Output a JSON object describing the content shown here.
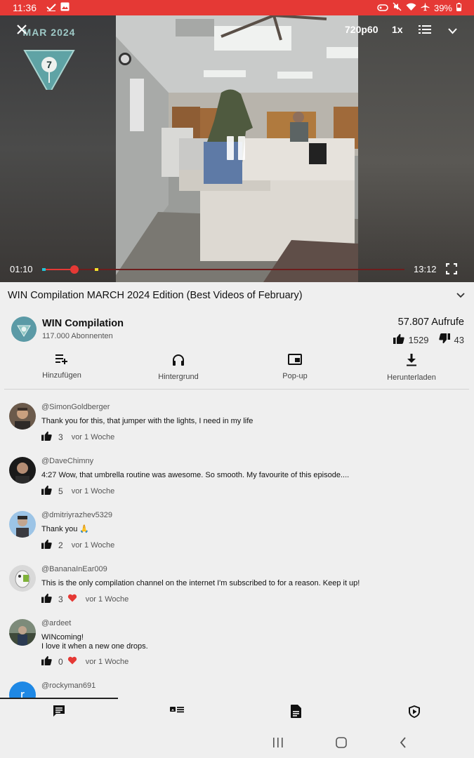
{
  "status_bar": {
    "time": "11:36",
    "battery": "39%"
  },
  "player": {
    "brand_text": "MAR 2024",
    "brand_number": "7",
    "quality": "720p60",
    "speed": "1x",
    "current_time": "01:10",
    "total_time": "13:12",
    "progress": 0.089
  },
  "video": {
    "title": "WIN Compilation MARCH 2024 Edition (Best Videos of February)",
    "channel_name": "WIN Compilation",
    "subscribers": "117.000 Abonnenten",
    "views": "57.807 Aufrufe",
    "likes": "1529",
    "dislikes": "43"
  },
  "actions": [
    {
      "label": "Hinzufügen",
      "icon": "playlist-add-icon"
    },
    {
      "label": "Hintergrund",
      "icon": "headphones-icon"
    },
    {
      "label": "Pop-up",
      "icon": "popup-icon"
    },
    {
      "label": "Herunterladen",
      "icon": "download-icon"
    }
  ],
  "comments": [
    {
      "user": "@SimonGoldberger",
      "text": "Thank you for this, that jumper with the lights, I need in my life",
      "likes": "3",
      "hearted": false,
      "ago": "vor 1 Woche"
    },
    {
      "user": "@DaveChimny",
      "text": "4:27 Wow, that umbrella routine was awesome. So smooth. My favourite of this episode....",
      "likes": "5",
      "hearted": false,
      "ago": "vor 1 Woche"
    },
    {
      "user": "@dmitriyrazhev5329",
      "text": "Thank you 🙏",
      "likes": "2",
      "hearted": false,
      "ago": "vor 1 Woche"
    },
    {
      "user": "@BananaInEar009",
      "text": "This is the only compilation channel on the internet I'm subscribed to for a reason. Keep it up!",
      "likes": "3",
      "hearted": true,
      "ago": "vor 1 Woche"
    },
    {
      "user": "@ardeet",
      "text": "WINcoming!\nI love it when a new one drops.",
      "likes": "0",
      "hearted": true,
      "ago": "vor 1 Woche"
    },
    {
      "user": "@rockyman691",
      "avatar_letter": "r"
    }
  ],
  "tabs": [
    {
      "icon": "comments-icon",
      "active": true
    },
    {
      "icon": "related-videos-icon",
      "active": false
    },
    {
      "icon": "description-icon",
      "active": false
    },
    {
      "icon": "sponsorblock-icon",
      "active": false
    }
  ],
  "colors": {
    "accent": "#e53935",
    "background": "#efefef",
    "brand": "#5b9aa6"
  }
}
